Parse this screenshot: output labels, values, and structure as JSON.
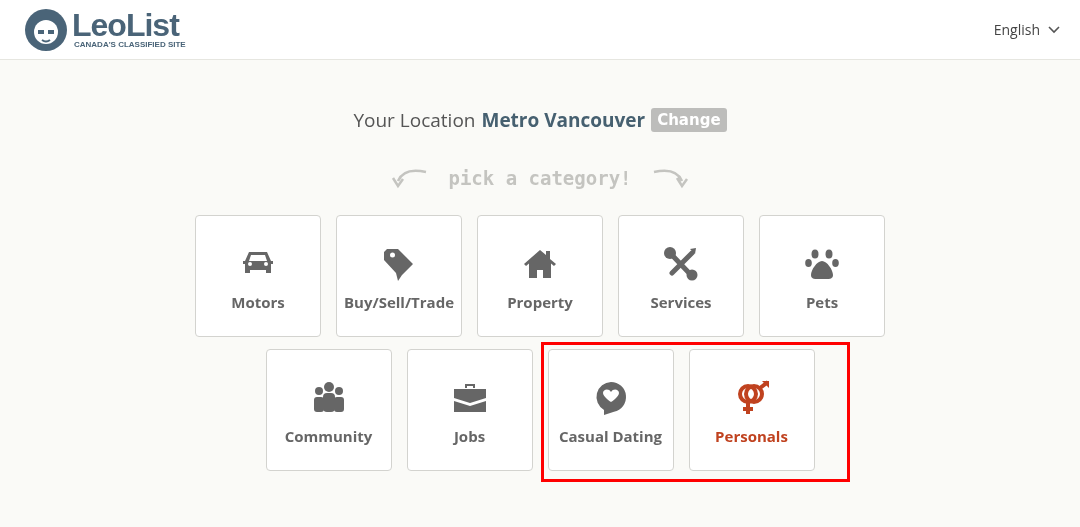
{
  "header": {
    "logo_name": "LeoList",
    "logo_tagline": "CANADA'S CLASSIFIED SITE",
    "language": "English"
  },
  "location": {
    "label": "Your Location",
    "value": "Metro Vancouver",
    "button": "Change"
  },
  "prompt": "pick a category!",
  "categories": [
    {
      "label": "Motors",
      "kind": "car",
      "color": "#666666",
      "highlighted": false
    },
    {
      "label": "Buy/Sell/Trade",
      "kind": "tag",
      "color": "#666666",
      "highlighted": false
    },
    {
      "label": "Property",
      "kind": "house",
      "color": "#666666",
      "highlighted": false
    },
    {
      "label": "Services",
      "kind": "tools",
      "color": "#666666",
      "highlighted": false
    },
    {
      "label": "Pets",
      "kind": "paw",
      "color": "#666666",
      "highlighted": false
    },
    {
      "label": "Community",
      "kind": "people",
      "color": "#666666",
      "highlighted": false
    },
    {
      "label": "Jobs",
      "kind": "briefcase",
      "color": "#666666",
      "highlighted": false
    },
    {
      "label": "Casual Dating",
      "kind": "chat",
      "color": "#666666",
      "highlighted": true
    },
    {
      "label": "Personals",
      "kind": "gender",
      "color": "#c0421f",
      "highlighted": true
    }
  ]
}
